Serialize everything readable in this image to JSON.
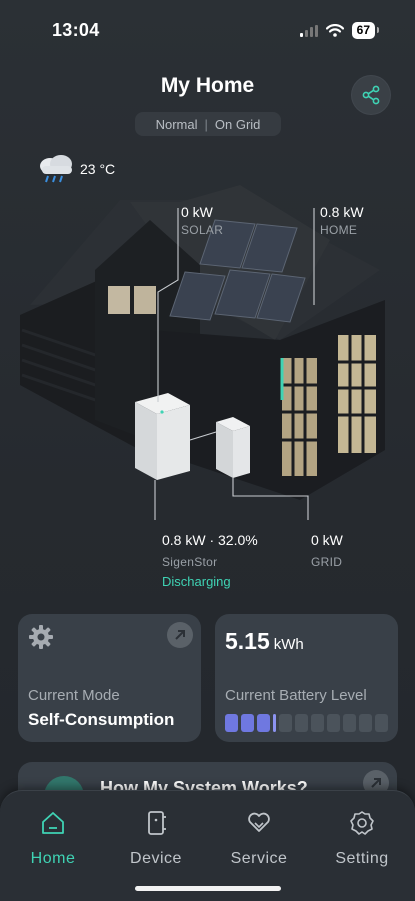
{
  "status_bar": {
    "time": "13:04",
    "battery": "67"
  },
  "header": {
    "title": "My Home",
    "mode": "Normal",
    "grid_status": "On Grid"
  },
  "weather": {
    "temperature": "23 °C"
  },
  "energy_flow": {
    "solar": {
      "value": "0 kW",
      "label": "SOLAR"
    },
    "home": {
      "value": "0.8 kW",
      "label": "HOME"
    },
    "battery": {
      "value": "0.8 kW · 32.0%",
      "label": "SigenStor",
      "state": "Discharging"
    },
    "grid": {
      "value": "0 kW",
      "label": "GRID"
    }
  },
  "cards": {
    "mode": {
      "label": "Current Mode",
      "value": "Self-Consumption"
    },
    "battery": {
      "value": "5.15",
      "unit": "kWh",
      "label": "Current Battery Level",
      "level_fraction": 0.32
    }
  },
  "how_card": {
    "title": "How My System Works?"
  },
  "tabs": [
    {
      "label": "Home",
      "icon": "home-icon",
      "active": true
    },
    {
      "label": "Device",
      "icon": "device-icon",
      "active": false
    },
    {
      "label": "Service",
      "icon": "service-icon",
      "active": false
    },
    {
      "label": "Setting",
      "icon": "setting-icon",
      "active": false
    }
  ],
  "colors": {
    "accent": "#3fd3b4",
    "battery_fill": "#6f78e0"
  }
}
